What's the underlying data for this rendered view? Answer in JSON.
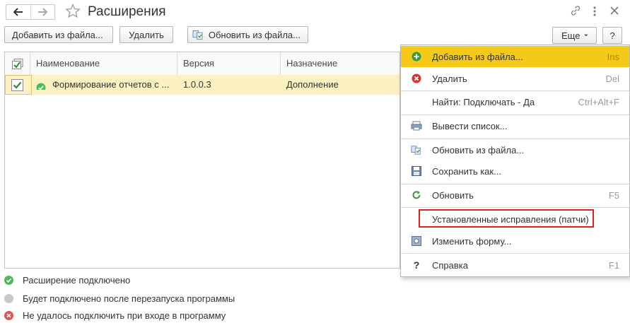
{
  "header": {
    "title": "Расширения"
  },
  "toolbar": {
    "add_from_file": "Добавить из файла...",
    "delete": "Удалить",
    "update_from_file": "Обновить из файла...",
    "more": "Еще",
    "help": "?"
  },
  "table": {
    "columns": [
      "Наименование",
      "Версия",
      "Назначение"
    ],
    "rows": [
      {
        "checked": true,
        "status": "connected",
        "name": "Формирование отчетов с ...",
        "version": "1.0.0.3",
        "purpose": "Дополнение"
      }
    ]
  },
  "legend": [
    {
      "label": "Расширение подключено",
      "color": "#4cbb5a"
    },
    {
      "label": "Будет подключено после перезапуска программы",
      "color": "#c8c8c8"
    },
    {
      "label": "Не удалось подключить при входе в программу",
      "color": "#e05555"
    }
  ],
  "menu": {
    "items": [
      {
        "label": "Добавить из файла...",
        "shortcut": "Ins",
        "icon": "add-circle-icon"
      },
      {
        "label": "Удалить",
        "shortcut": "Del",
        "icon": "delete-circle-icon"
      },
      {
        "label": "Найти: Подключать - Да",
        "shortcut": "Ctrl+Alt+F",
        "icon": ""
      },
      {
        "label": "Вывести список...",
        "shortcut": "",
        "icon": "print-list-icon"
      },
      {
        "label": "Обновить из файла...",
        "shortcut": "",
        "icon": "update-file-icon"
      },
      {
        "label": "Сохранить как...",
        "shortcut": "",
        "icon": "save-disk-icon"
      },
      {
        "label": "Обновить",
        "shortcut": "F5",
        "icon": "refresh-icon"
      },
      {
        "label": "Установленные исправления (патчи)",
        "shortcut": "",
        "icon": ""
      },
      {
        "label": "Изменить форму...",
        "shortcut": "",
        "icon": "change-form-icon"
      },
      {
        "label": "Справка",
        "shortcut": "F1",
        "icon": "help-question-icon"
      }
    ]
  },
  "colors": {
    "highlight": "#f5c917",
    "row_selected": "#fbf1c2",
    "annotation_border": "#e02020"
  }
}
